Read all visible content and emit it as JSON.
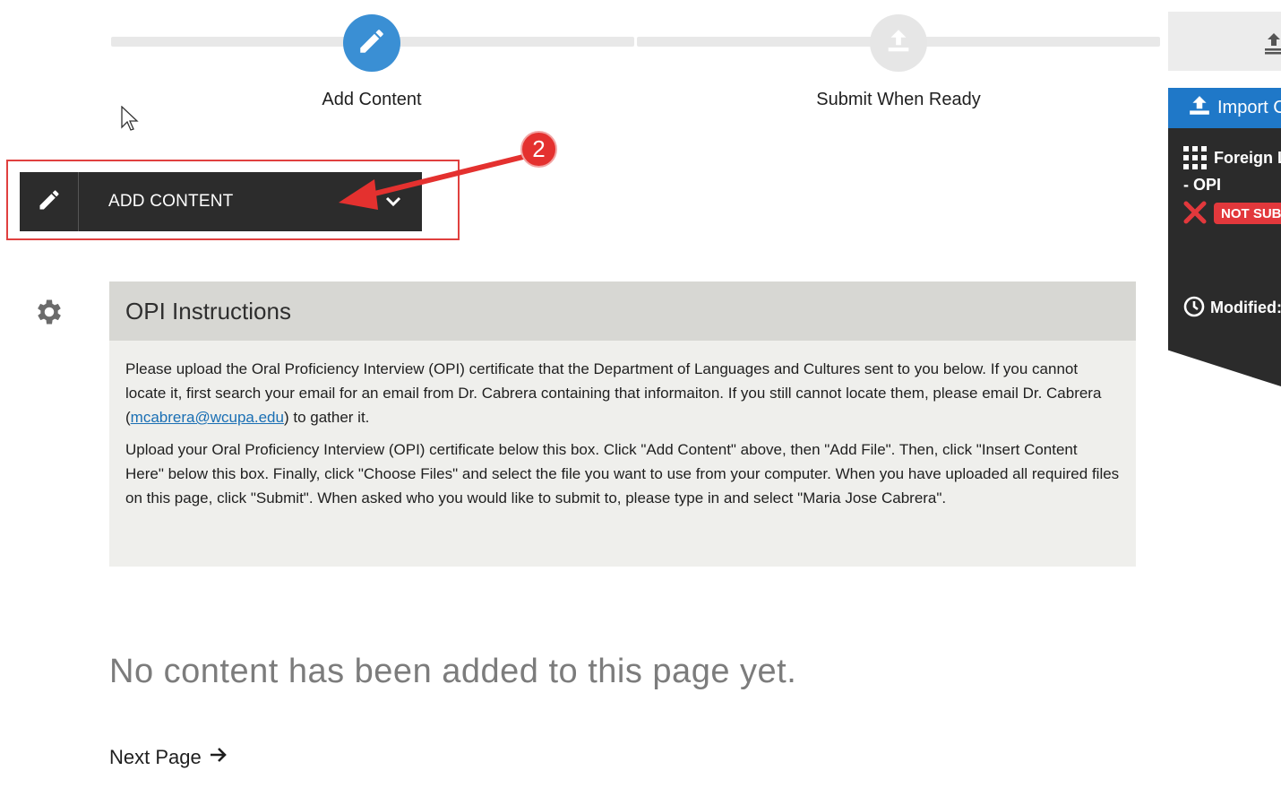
{
  "stepper": {
    "steps": [
      {
        "label": "Add Content",
        "icon": "pencil-icon",
        "active": true
      },
      {
        "label": "Submit When Ready",
        "icon": "upload-icon",
        "active": false
      }
    ],
    "active_color": "#3a8fd4",
    "inactive_color": "#e6e6e6"
  },
  "add_content_button": {
    "label": "ADD CONTENT",
    "icon": "pencil-icon",
    "dropdown_icon": "chevron-down-icon"
  },
  "annotation": {
    "badge_number": "2",
    "color": "#e4312f"
  },
  "instructions": {
    "title": "OPI Instructions",
    "paragraph1_before": "Please upload the Oral Proficiency Interview (OPI) certificate that the Department of Languages and Cultures sent to you below.  If you cannot locate it, first search your email for an email from Dr. Cabrera containing that informaiton.  If you still cannot locate them, please email Dr. Cabrera (",
    "email": "mcabrera@wcupa.edu",
    "paragraph1_after": ") to gather it.",
    "paragraph2": "Upload your Oral Proficiency Interview (OPI) certificate below this box.  Click \"Add Content\" above, then \"Add File\".  Then, click \"Insert Content Here\" below this box.  Finally, click \"Choose Files\" and select the file you want to use from your computer.  When you have uploaded all required files on this page, click \"Submit\".  When asked who you would like to submit to, please type in and select \"Maria Jose Cabrera\"."
  },
  "empty_message": "No content has been added to this page yet.",
  "next_page": {
    "label": "Next Page",
    "icon": "arrow-right-icon"
  },
  "sidebar": {
    "import_label": "Import C",
    "item_title": "Foreign L",
    "item_subtitle": "- OPI",
    "status": "NOT SUB",
    "modified_label": "Modified:"
  }
}
